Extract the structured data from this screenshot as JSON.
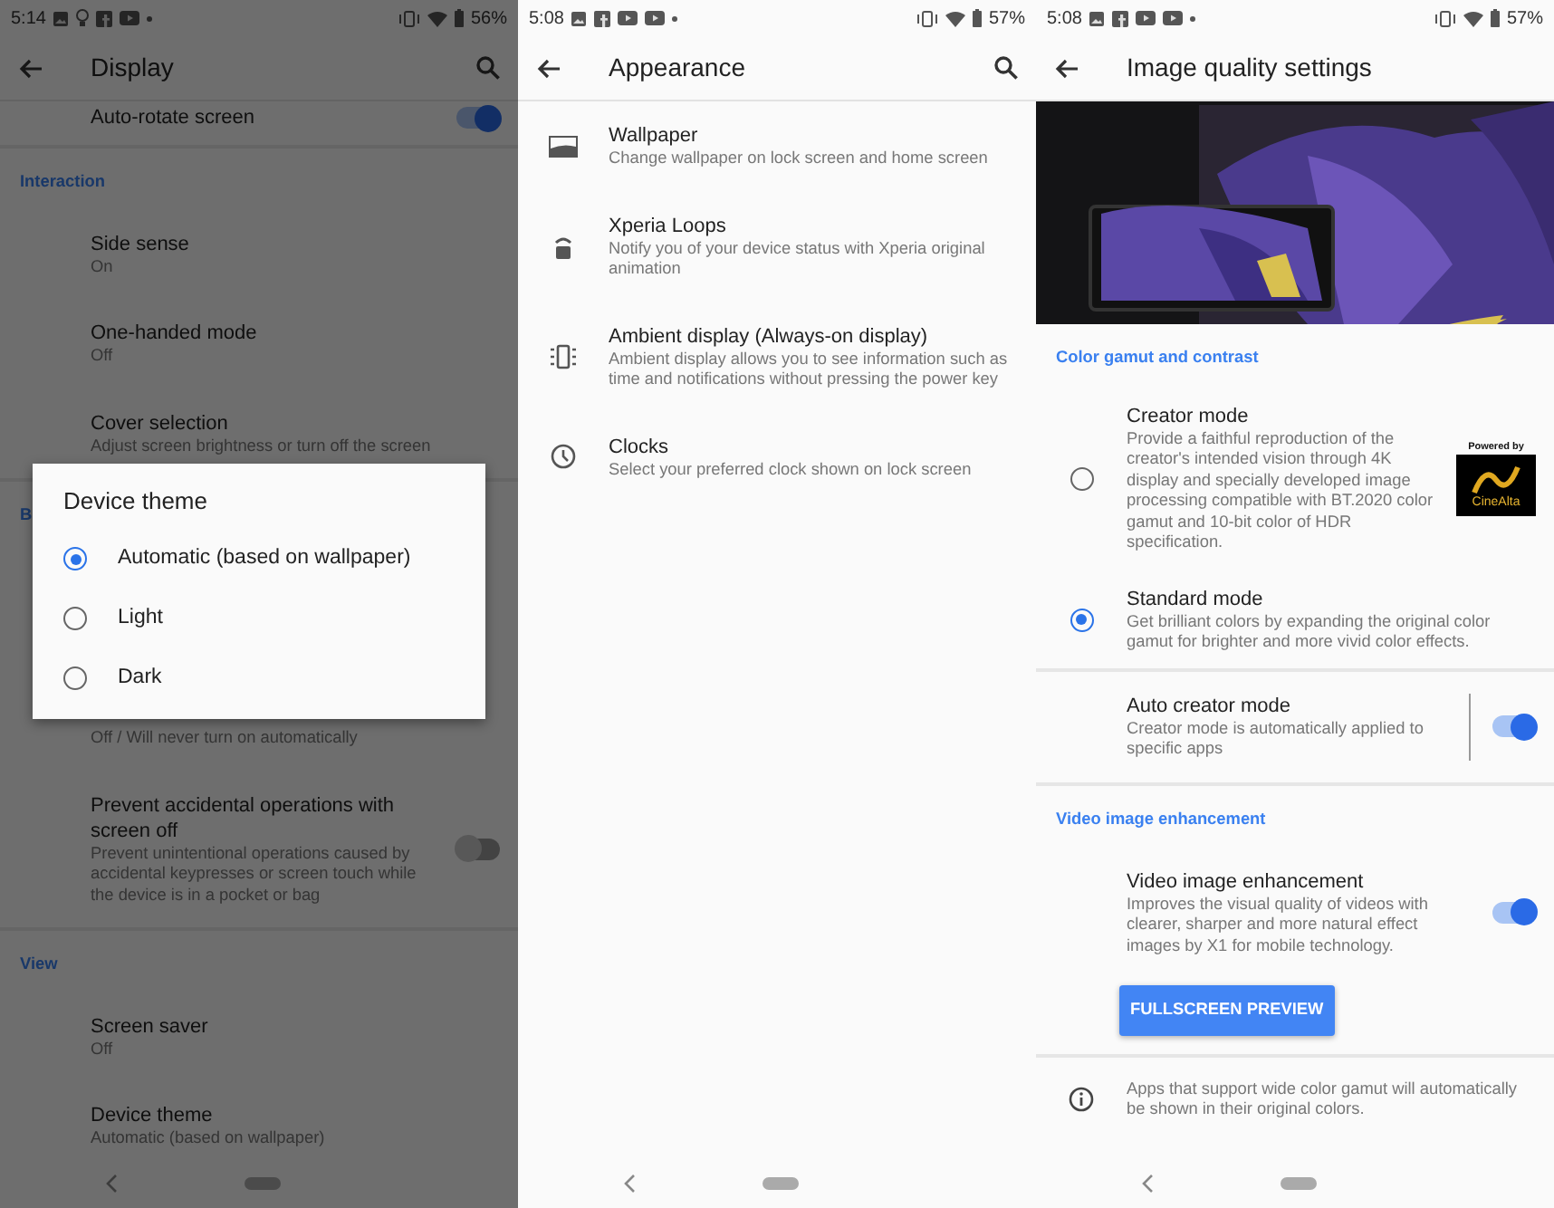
{
  "panels": [
    {
      "dimmed": true,
      "status_bar": {
        "time": "5:14",
        "battery": "56%"
      },
      "toolbar": {
        "title": "Display",
        "search": true
      },
      "list": [
        {
          "kind": "toggle",
          "title": "Auto-rotate screen",
          "on": true
        },
        {
          "kind": "divider"
        },
        {
          "kind": "header",
          "title": "Interaction"
        },
        {
          "kind": "item",
          "title": "Side sense",
          "subtitle": "On"
        },
        {
          "kind": "item",
          "title": "One-handed mode",
          "subtitle": "Off"
        },
        {
          "kind": "item",
          "title": "Cover selection",
          "subtitle": "Adjust screen brightness or turn off the screen"
        },
        {
          "kind": "divider"
        },
        {
          "kind": "header",
          "title": "B"
        },
        {
          "kind": "spacer"
        },
        {
          "kind": "item",
          "subtitle": "Off / Will never turn on automatically"
        },
        {
          "kind": "toggle",
          "title": "Prevent accidental operations with screen off",
          "subtitle": "Prevent unintentional operations caused by accidental keypresses or screen touch while the device is in a pocket or bag",
          "on": false
        },
        {
          "kind": "divider"
        },
        {
          "kind": "header",
          "title": "View"
        },
        {
          "kind": "item",
          "title": "Screen saver",
          "subtitle": "Off"
        },
        {
          "kind": "item",
          "title": "Device theme",
          "subtitle": "Automatic (based on wallpaper)"
        }
      ],
      "dialog": {
        "title": "Device theme",
        "options": [
          {
            "label": "Automatic (based on wallpaper)",
            "selected": true
          },
          {
            "label": "Light",
            "selected": false
          },
          {
            "label": "Dark",
            "selected": false
          }
        ]
      }
    },
    {
      "dimmed": false,
      "status_bar": {
        "time": "5:08",
        "battery": "57%"
      },
      "toolbar": {
        "title": "Appearance",
        "search": true
      },
      "list": [
        {
          "kind": "item",
          "title": "Wallpaper",
          "subtitle": "Change wallpaper on lock screen and home screen"
        },
        {
          "kind": "item",
          "title": "Xperia Loops",
          "subtitle": "Notify you of your device status with Xperia original animation"
        },
        {
          "kind": "item",
          "title": "Ambient display (Always-on display)",
          "subtitle": "Ambient display allows you to see information such as time and notifications without pressing the power key"
        },
        {
          "kind": "item",
          "title": "Clocks",
          "subtitle": "Select your preferred clock shown on lock screen"
        }
      ]
    },
    {
      "dimmed": false,
      "status_bar": {
        "time": "5:08",
        "battery": "57%"
      },
      "toolbar": {
        "title": "Image quality settings",
        "search": false
      },
      "list": [
        {
          "kind": "picture"
        },
        {
          "kind": "header",
          "title": "Color gamut and contrast"
        },
        {
          "kind": "radio",
          "title": "Creator mode",
          "subtitle": "Provide a faithful reproduction of the creator's intended vision through 4K display and specially developed image processing compatible with BT.2020 color gamut and 10-bit color of HDR specification.",
          "selected": false,
          "badge": {
            "caption": "Powered by",
            "name": "CineAlta"
          }
        },
        {
          "kind": "radio",
          "title": "Standard mode",
          "subtitle": "Get brilliant colors by expanding the original color gamut for brighter and more vivid color effects.",
          "selected": true
        },
        {
          "kind": "divider"
        },
        {
          "kind": "toggle",
          "title": "Auto creator mode",
          "subtitle": "Creator mode is automatically applied to specific apps",
          "on": true,
          "separator": true
        },
        {
          "kind": "divider"
        },
        {
          "kind": "header",
          "title": "Video image enhancement"
        },
        {
          "kind": "toggle",
          "title": "Video image enhancement",
          "subtitle": "Improves the visual quality of videos with clearer, sharper and more natural effect images by X1 for mobile technology.",
          "on": true
        },
        {
          "kind": "button",
          "label": "FULLSCREEN PREVIEW"
        },
        {
          "kind": "divider"
        },
        {
          "kind": "item",
          "subtitle": "Apps that support wide color gamut will automatically be shown in their original colors."
        }
      ]
    }
  ]
}
